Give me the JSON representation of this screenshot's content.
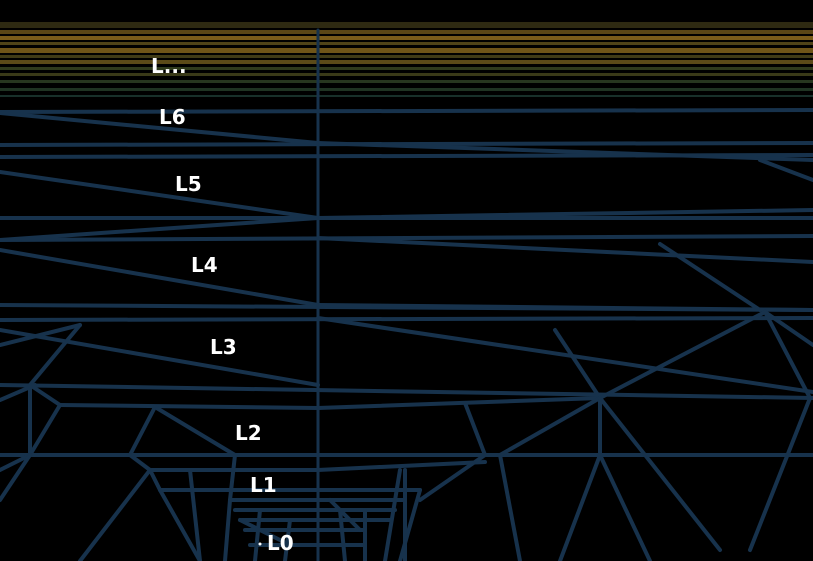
{
  "colors": {
    "background": "#000000",
    "wire": "#17324c",
    "far_band": "#6e5418",
    "far_band_dim": "#2c3a20",
    "label": "#ffffff"
  },
  "labels": {
    "l_more": "L...",
    "l6": "L6",
    "l5": "L5",
    "l4": "L4",
    "l3": "L3",
    "l2": "L2",
    "l1": "L1",
    "l0": "L0"
  }
}
